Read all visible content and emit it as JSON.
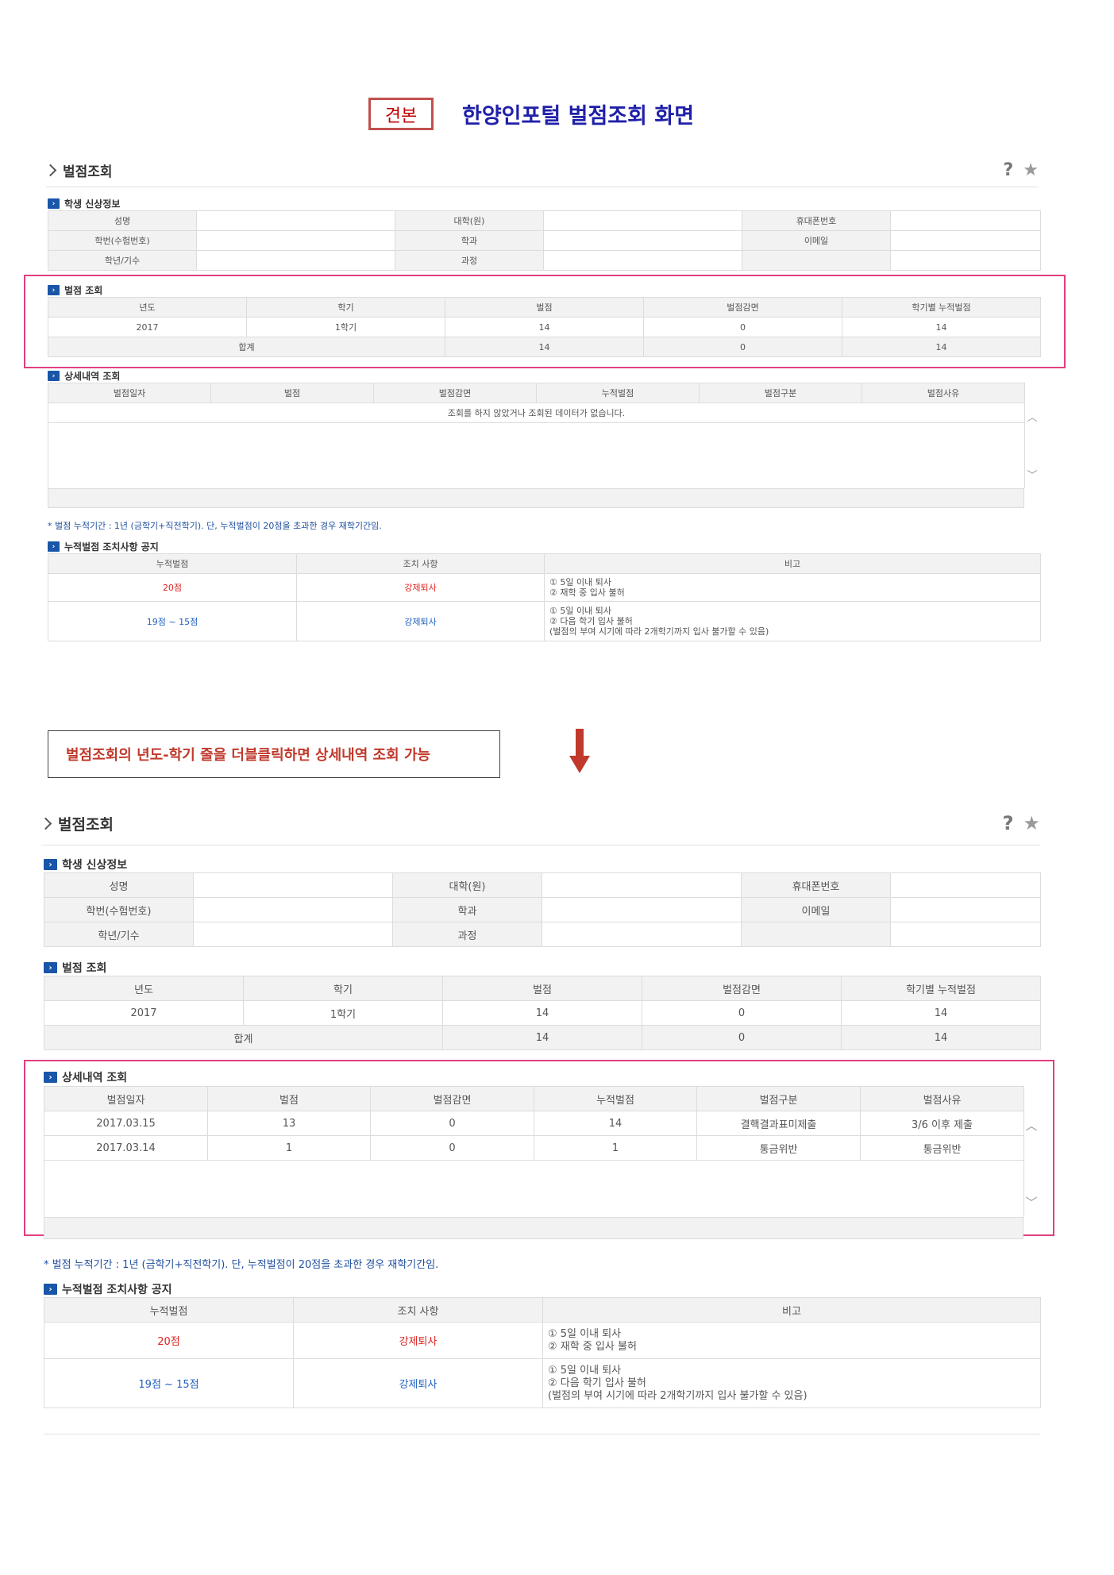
{
  "header": {
    "sample_label": "견본",
    "doc_title": "한양인포털 벌점조회 화면"
  },
  "callout": {
    "text": "벌점조회의 년도-학기 줄을 더블클릭하면 상세내역 조회 가능"
  },
  "page": {
    "panel_title": "벌점조회",
    "help_icon": "question-icon",
    "favorite_icon": "star-icon",
    "student": {
      "title": "학생 신상정보",
      "labels": {
        "name": "성명",
        "college": "대학(원)",
        "phone": "휴대폰번호",
        "student_no": "학번(수험번호)",
        "dept": "학과",
        "email": "이메일",
        "year_gen": "학년/기수",
        "course": "과정"
      }
    },
    "penalty": {
      "title": "벌점 조회",
      "headers": [
        "년도",
        "학기",
        "벌점",
        "벌점감면",
        "학기별 누적벌점"
      ],
      "rows": [
        {
          "year": "2017",
          "semester": "1학기",
          "points": "14",
          "reduction": "0",
          "cumulative": "14"
        }
      ],
      "total": {
        "label": "합계",
        "points": "14",
        "reduction": "0",
        "cumulative": "14"
      }
    },
    "detail": {
      "title": "상세내역 조회",
      "headers": [
        "벌점일자",
        "벌점",
        "벌점감면",
        "누적벌점",
        "벌점구분",
        "벌점사유"
      ],
      "empty_message": "조회를 하지 않았거나 조회된 데이터가 없습니다.",
      "rows": [
        {
          "date": "2017.03.15",
          "points": "13",
          "reduction": "0",
          "cumulative": "14",
          "category": "결핵결과표미제출",
          "reason": "3/6 이후 제출"
        },
        {
          "date": "2017.03.14",
          "points": "1",
          "reduction": "0",
          "cumulative": "1",
          "category": "통금위반",
          "reason": "통금위반"
        }
      ]
    },
    "note": "* 벌점 누적기간 : 1년 (금학기+직전학기). 단, 누적벌점이 20점을 초과한 경우 재학기간임.",
    "action": {
      "title": "누적벌점 조치사항 공지",
      "headers": [
        "누적벌점",
        "조치 사항",
        "비고"
      ],
      "rows": [
        {
          "points": "20점",
          "measure": "강제퇴사",
          "remarks": [
            "① 5일 이내 퇴사",
            "② 재학 중 입사 불허"
          ]
        },
        {
          "points": "19점 ~ 15점",
          "measure": "강제퇴사",
          "remarks": [
            "① 5일 이내 퇴사",
            "② 다음 학기 입사 불허",
            "(벌점의 부여 시기에 따라 2개학기까지 입사 불가할 수 있음)"
          ]
        }
      ]
    }
  },
  "colors": {
    "accent_blue": "#1a56a8",
    "title_blue": "#1f1fa8",
    "highlight_pink": "#e04080",
    "sample_red": "#c0504d",
    "warn_red": "#e02020"
  }
}
